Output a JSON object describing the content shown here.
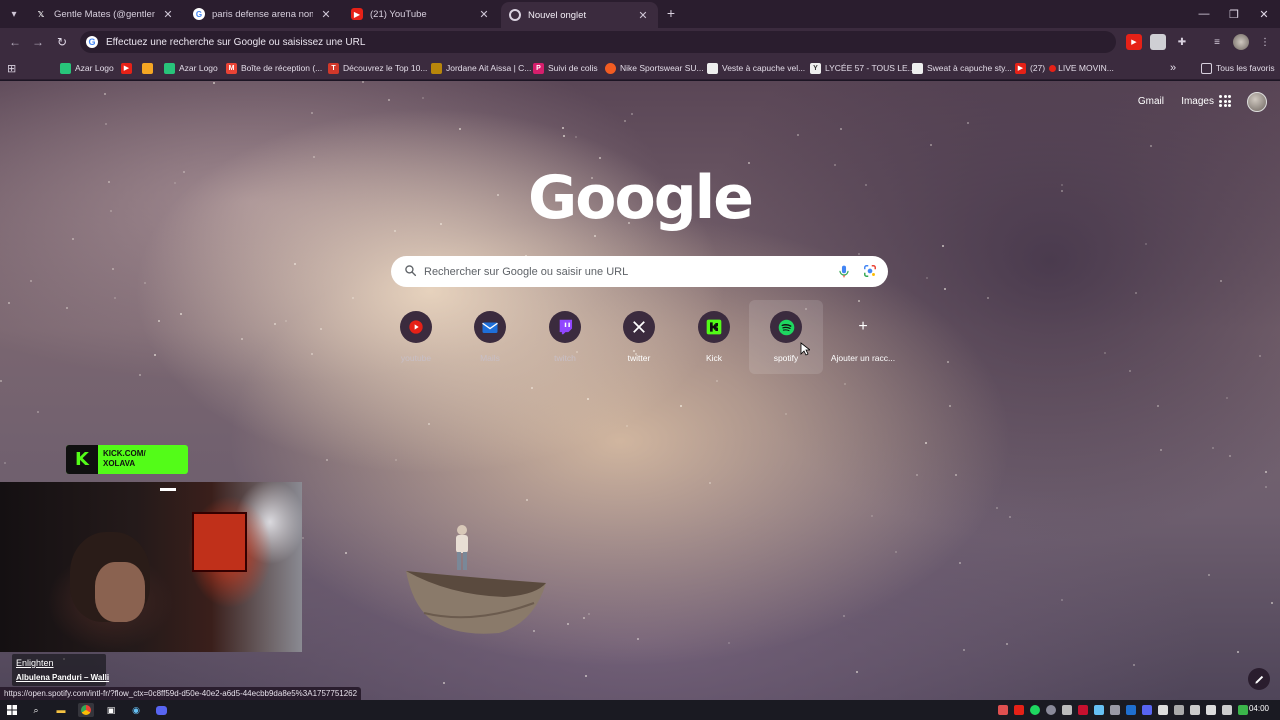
{
  "tabs": [
    {
      "title": "Gentle Mates (@gentlemates) /",
      "favicon": "x-icon"
    },
    {
      "title": "paris defense arena nombre de",
      "favicon": "google-icon"
    },
    {
      "title": "(21) YouTube",
      "favicon": "youtube-icon"
    },
    {
      "title": "Nouvel onglet",
      "favicon": "chrome-icon"
    }
  ],
  "omnibox": {
    "text": "Effectuez une recherche sur Google ou saisissez une URL"
  },
  "bookmarks": {
    "items": [
      {
        "label": "Azar Logo",
        "color": "#28c47a"
      },
      {
        "label": "",
        "color": "#e62117"
      },
      {
        "label": "",
        "color": "#f5a623"
      },
      {
        "label": "Azar Logo",
        "color": "#28c47a"
      },
      {
        "label": "Boîte de réception (...",
        "color": "#ea4335"
      },
      {
        "label": "Découvrez le Top 10...",
        "color": "#d1382a"
      },
      {
        "label": "Jordane Ait Aissa | C...",
        "color": "#b8860b"
      },
      {
        "label": "Suivi de colis",
        "color": "#d61e6c"
      },
      {
        "label": "Nike Sportswear SU...",
        "color": "#f25c22"
      },
      {
        "label": "Veste à capuche vel...",
        "color": "#eeeeee"
      },
      {
        "label": "LYCÉE 57 - TOUS LE...",
        "color": "#eeeeee"
      },
      {
        "label": "Sweat à capuche sty...",
        "color": "#eeeeee"
      },
      {
        "label": "(27)",
        "color": "#e62117"
      },
      {
        "label": "LIVE MOVIN...",
        "color": "#e62117"
      }
    ],
    "all_label": "Tous les favoris"
  },
  "page": {
    "gmail": "Gmail",
    "images": "Images",
    "logo": "Google",
    "search_placeholder": "Rechercher sur Google ou saisir une URL",
    "shortcuts": [
      {
        "label": "youtube",
        "icon": "youtube-icon"
      },
      {
        "label": "Mails",
        "icon": "mail-icon"
      },
      {
        "label": "twitch",
        "icon": "twitch-icon"
      },
      {
        "label": "twitter",
        "icon": "x-icon"
      },
      {
        "label": "Kick",
        "icon": "kick-icon"
      },
      {
        "label": "spotify",
        "icon": "spotify-icon"
      },
      {
        "label": "Ajouter un racc...",
        "icon": "plus-icon"
      }
    ]
  },
  "overlay": {
    "kick_line1": "KICK.COM/",
    "kick_line2": "XOLAVA",
    "song_title": "Enlighten",
    "song_artist": "Albulena Panduri – Walli"
  },
  "status_url": "https://open.spotify.com/intl-fr/?flow_ctx=0c8ff59d-d50e-40e2-a6d5-44ecbb9da8e5%3A1757751262",
  "taskbar": {
    "clock": "04:00"
  },
  "colors": {
    "accent": "#3b2b3e",
    "tabstrip": "#2a1d2e",
    "kick_green": "#53fc18"
  }
}
